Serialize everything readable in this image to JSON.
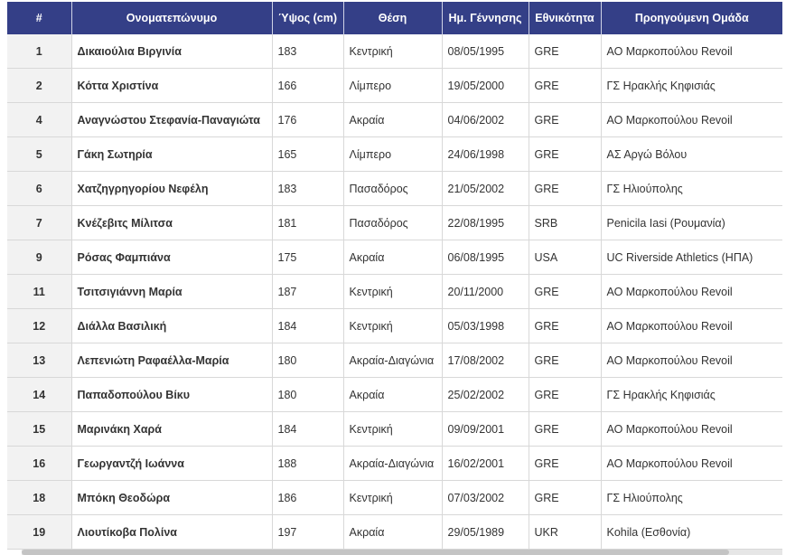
{
  "table": {
    "columns": [
      "#",
      "Ονοματεπώνυμο",
      "Ύψος (cm)",
      "Θέση",
      "Ημ. Γέννησης",
      "Εθνικότητα",
      "Προηγούμενη Ομάδα"
    ],
    "rows": [
      {
        "number": "1",
        "name": "Δικαιούλια Βιργινία",
        "height": "183",
        "position": "Κεντρική",
        "dob": "08/05/1995",
        "nationality": "GRE",
        "previous_team": "ΑΟ Μαρκοπούλου Revoil"
      },
      {
        "number": "2",
        "name": "Κόττα Χριστίνα",
        "height": "166",
        "position": "Λίμπερο",
        "dob": "19/05/2000",
        "nationality": "GRE",
        "previous_team": "ΓΣ Ηρακλής Κηφισιάς"
      },
      {
        "number": "4",
        "name": "Αναγνώστου Στεφανία-Παναγιώτα",
        "height": "176",
        "position": "Ακραία",
        "dob": "04/06/2002",
        "nationality": "GRE",
        "previous_team": "ΑΟ Μαρκοπούλου Revoil"
      },
      {
        "number": "5",
        "name": "Γάκη Σωτηρία",
        "height": "165",
        "position": "Λίμπερο",
        "dob": "24/06/1998",
        "nationality": "GRE",
        "previous_team": "ΑΣ Αργώ Βόλου"
      },
      {
        "number": "6",
        "name": "Χατζηγρηγορίου Νεφέλη",
        "height": "183",
        "position": "Πασαδόρος",
        "dob": "21/05/2002",
        "nationality": "GRE",
        "previous_team": "ΓΣ Ηλιούπολης"
      },
      {
        "number": "7",
        "name": "Κνέζεβιτς Μίλιτσα",
        "height": "181",
        "position": "Πασαδόρος",
        "dob": "22/08/1995",
        "nationality": "SRB",
        "previous_team": "Penicila Iasi (Ρουμανία)"
      },
      {
        "number": "9",
        "name": "Ρόσας Φαμπιάνα",
        "height": "175",
        "position": "Ακραία",
        "dob": "06/08/1995",
        "nationality": "USA",
        "previous_team": "UC Riverside Athletics (ΗΠΑ)"
      },
      {
        "number": "11",
        "name": "Τσιτσιγιάννη Μαρία",
        "height": "187",
        "position": "Κεντρική",
        "dob": "20/11/2000",
        "nationality": "GRE",
        "previous_team": "ΑΟ Μαρκοπούλου Revoil"
      },
      {
        "number": "12",
        "name": "Διάλλα Βασιλική",
        "height": "184",
        "position": "Κεντρική",
        "dob": "05/03/1998",
        "nationality": "GRE",
        "previous_team": "ΑΟ Μαρκοπούλου Revoil"
      },
      {
        "number": "13",
        "name": "Λεπενιώτη Ραφαέλλα-Μαρία",
        "height": "180",
        "position": "Ακραία-Διαγώνια",
        "dob": "17/08/2002",
        "nationality": "GRE",
        "previous_team": "ΑΟ Μαρκοπούλου Revoil"
      },
      {
        "number": "14",
        "name": "Παπαδοπούλου Βίκυ",
        "height": "180",
        "position": "Ακραία",
        "dob": "25/02/2002",
        "nationality": "GRE",
        "previous_team": "ΓΣ Ηρακλής Κηφισιάς"
      },
      {
        "number": "15",
        "name": "Μαρινάκη Χαρά",
        "height": "184",
        "position": "Κεντρική",
        "dob": "09/09/2001",
        "nationality": "GRE",
        "previous_team": "ΑΟ Μαρκοπούλου Revoil"
      },
      {
        "number": "16",
        "name": "Γεωργαντζή Ιωάννα",
        "height": "188",
        "position": "Ακραία-Διαγώνια",
        "dob": "16/02/2001",
        "nationality": "GRE",
        "previous_team": "ΑΟ Μαρκοπούλου Revoil"
      },
      {
        "number": "18",
        "name": "Μπόκη Θεοδώρα",
        "height": "186",
        "position": "Κεντρική",
        "dob": "07/03/2002",
        "nationality": "GRE",
        "previous_team": "ΓΣ Ηλιούπολης"
      },
      {
        "number": "19",
        "name": "Λιουτίκοβα Πολίνα",
        "height": "197",
        "position": "Ακραία",
        "dob": "29/05/1989",
        "nationality": "UKR",
        "previous_team": "Kohila (Εσθονία)"
      }
    ]
  },
  "colors": {
    "header_bg": "#343f87",
    "header_text": "#ffffff",
    "number_cell_bg": "#f2f2f2",
    "row_border": "#d8d8d8"
  },
  "scroll": {
    "horizontal_thumb_fraction": 0.93
  }
}
